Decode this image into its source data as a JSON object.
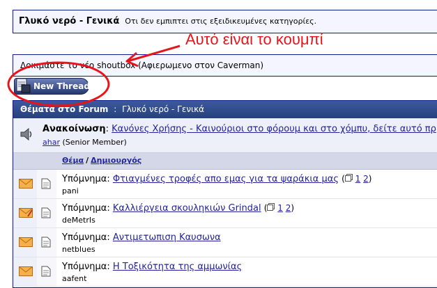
{
  "forum": {
    "name": "Γλυκό νερό - Γενικά",
    "description": "Οτι δεν εμπιπτει στις εξειδικευμένες κατηγορίες."
  },
  "annotation": "Αυτό είναι το κουμπί",
  "shoutbox": {
    "text": "Δοκιμάστε το νέο shoutbox (Αφιερωμενο στον Caverman)"
  },
  "new_thread_label": "New Thread",
  "category": {
    "title": "Θέματα στο Forum",
    "separator": ":",
    "name": "Γλυκό νερό - Γενικά"
  },
  "announcement": {
    "label": "Ανακοίνωση",
    "separator": ":",
    "title": "Κανόνες Χρήσης - Καινούριοι στο φόρουμ και στο χόμπυ, δείτε αυτό πρ",
    "author": "ahar",
    "author_role": "(Senior Member)"
  },
  "columns": {
    "thread": "Θέμα",
    "slash": "/",
    "creator": "Δημιουργός"
  },
  "threads": [
    {
      "prefix": "Υπόμνημα:",
      "title": "Φτιαγμένες τροφές απο εμας για τα ψαράκια μας",
      "pages_open": "(",
      "page1": "1",
      "page2": "2",
      "pages_close": ")",
      "author": "pani"
    },
    {
      "prefix": "Υπόμνημα:",
      "title": "Καλλιέργεια σκουληκιών Grindal",
      "pages_open": "(",
      "page1": "1",
      "page2": "2",
      "pages_close": ")",
      "author": "deMetrIs"
    },
    {
      "prefix": "Υπόμνημα:",
      "title": "Αντιμετωπιση Καυσωνα",
      "author": "netblues"
    },
    {
      "prefix": "Υπόμνημα:",
      "title": "Η Τοξικότητα της αμμωνίας",
      "author": "aafent"
    }
  ],
  "colors": {
    "border": "#0b198c",
    "header": "#3d5a9e",
    "link": "#22229c",
    "annotation": "#e8141b",
    "envelope": "#f2a033"
  }
}
